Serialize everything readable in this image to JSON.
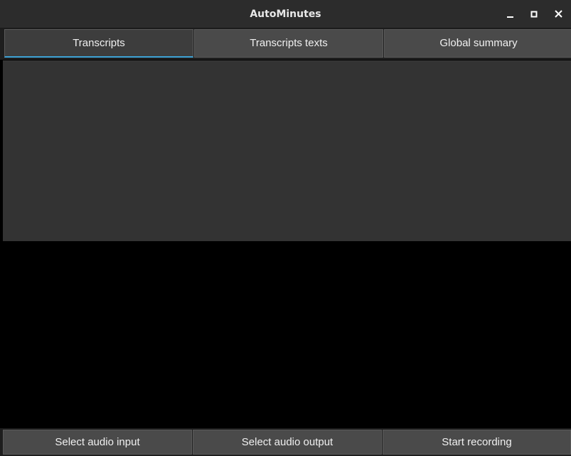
{
  "window": {
    "title": "AutoMinutes",
    "controls": {
      "minimize_icon": "minimize-icon",
      "maximize_icon": "maximize-icon",
      "close_icon": "close-icon"
    }
  },
  "tabs": [
    {
      "label": "Transcripts",
      "active": true
    },
    {
      "label": "Transcripts texts",
      "active": false
    },
    {
      "label": "Global summary",
      "active": false
    }
  ],
  "actions": {
    "select_input_label": "Select audio input",
    "select_output_label": "Select audio output",
    "start_recording_label": "Start recording"
  },
  "colors": {
    "accent": "#3ea3d6",
    "button_bg": "#4a4a4a",
    "panel_bg": "#333333",
    "titlebar_bg": "#2c2c2c"
  }
}
